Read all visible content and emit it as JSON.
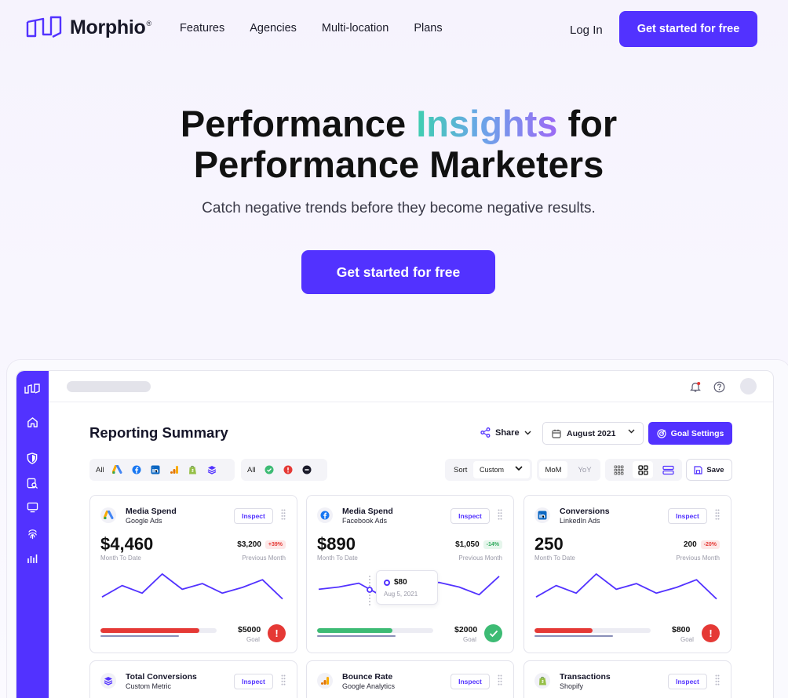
{
  "brand": {
    "name": "Morphio",
    "mark": "®",
    "accent": "#5232ff"
  },
  "nav": {
    "links": [
      "Features",
      "Agencies",
      "Multi-location",
      "Plans"
    ],
    "login": "Log In",
    "cta": "Get started for free"
  },
  "hero": {
    "title_part1": "Performance ",
    "title_highlight": "Insights",
    "title_part2": " for",
    "title_line2": "Performance Marketers",
    "subtitle": "Catch negative trends before they become negative results.",
    "cta": "Get started for free"
  },
  "dashboard": {
    "title": "Reporting Summary",
    "share": "Share",
    "date": "August 2021",
    "goal_settings": "Goal Settings",
    "filter_all_1": "All",
    "filter_all_2": "All",
    "sort_label": "Sort",
    "sort_value": "Custom",
    "mom": "MoM",
    "yoy": "YoY",
    "save": "Save",
    "cards": [
      {
        "title": "Media Spend",
        "source": "Google Ads",
        "icon": "google-ads-icon",
        "value": "$4,460",
        "value_label": "Month To Date",
        "prev": "$3,200",
        "change": "+39%",
        "change_type": "red",
        "prev_label": "Previous Month",
        "goal": "$5000",
        "goal_label": "Goal",
        "progress": 0.85,
        "progress_color": "#e53935",
        "status": "alert",
        "inspect": "Inspect",
        "series": [
          2,
          5,
          3,
          8,
          4,
          5.5,
          3,
          4.5,
          6.5,
          1.5
        ]
      },
      {
        "title": "Media Spend",
        "source": "Facebook Ads",
        "icon": "facebook-icon",
        "value": "$890",
        "value_label": "Month To Date",
        "prev": "$1,050",
        "change": "-14%",
        "change_type": "green",
        "prev_label": "Previous Month",
        "goal": "$2000",
        "goal_label": "Goal",
        "progress": 0.65,
        "progress_color": "#3dbb74",
        "status": "ok",
        "inspect": "Inspect",
        "tooltip_value": "$80",
        "tooltip_date": "Aug 5, 2021",
        "series": [
          4,
          4.6,
          5.6,
          2.7,
          5.5,
          5.4,
          5.8,
          4.6,
          2.6,
          7.4
        ]
      },
      {
        "title": "Conversions",
        "source": "LinkedIn Ads",
        "icon": "linkedin-icon",
        "value": "250",
        "value_label": "Month To Date",
        "prev": "200",
        "change": "-20%",
        "change_type": "red",
        "prev_label": "Previous Month",
        "goal": "$800",
        "goal_label": "Goal",
        "progress": 0.5,
        "progress_color": "#e53935",
        "status": "alert",
        "inspect": "Inspect",
        "series": [
          2,
          5,
          3,
          8,
          4,
          5.5,
          3,
          4.5,
          6.5,
          1.5
        ]
      }
    ],
    "cards_row2": [
      {
        "title": "Total Conversions",
        "source": "Custom Metric",
        "icon": "layers-icon",
        "inspect": "Inspect"
      },
      {
        "title": "Bounce Rate",
        "source": "Google Analytics",
        "icon": "analytics-icon",
        "inspect": "Inspect"
      },
      {
        "title": "Transactions",
        "source": "Shopify",
        "icon": "shopify-icon",
        "inspect": "Inspect"
      }
    ]
  }
}
